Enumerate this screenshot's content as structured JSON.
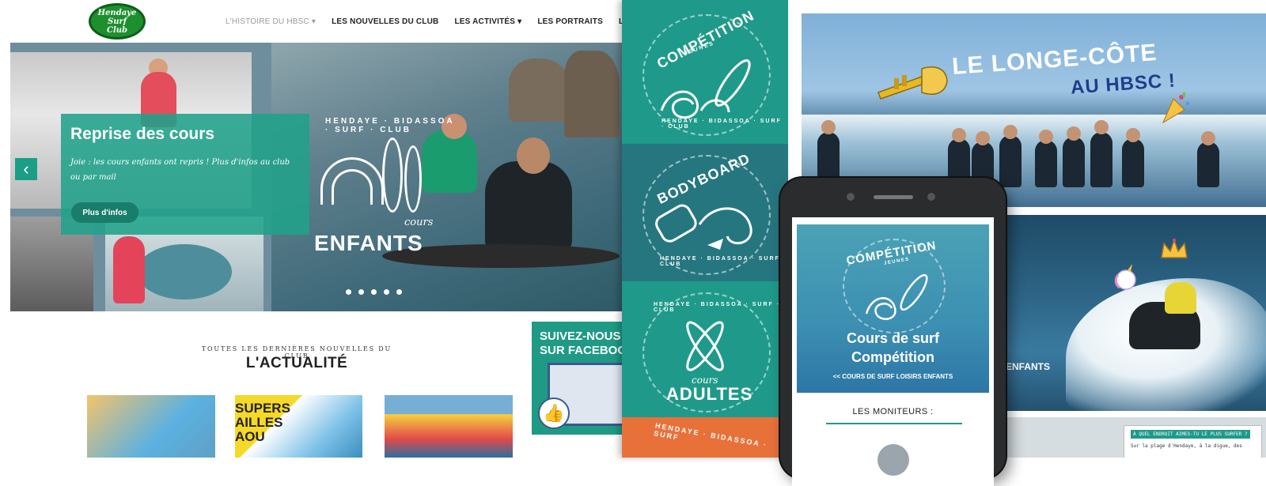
{
  "site": {
    "logo_line1": "Hendaye",
    "logo_line2": "Surf",
    "logo_line3": "Club",
    "nav": [
      {
        "label": "L'HISTOIRE DU HBSC",
        "caret": "▾",
        "active": false
      },
      {
        "label": "LES NOUVELLES DU CLUB",
        "caret": "",
        "active": true
      },
      {
        "label": "LES ACTIVITÉS",
        "caret": "▾",
        "active": true
      },
      {
        "label": "LES PORTRAITS",
        "caret": "",
        "active": true
      },
      {
        "label": "LES PRÉVISIONS",
        "caret": "",
        "active": true
      }
    ],
    "hero": {
      "title": "Reprise des cours",
      "text": "Joie : les cours enfants ont repris ! Plus d'infos au club ou par mail",
      "button": "Plus d'infos",
      "prev_icon": "chevron-left-icon",
      "slide_count": 5,
      "badge_arc": "HENDAYE · BIDASSOA · SURF · CLUB",
      "badge_cours": "cours",
      "badge_title": "ENFANTS"
    },
    "news": {
      "subtitle": "TOUTES LES DERNIÈRES NOUVELLES DU CLUB",
      "title": "L'ACTUALITÉ",
      "thumb2_text": "SUPERS\nAILLES\nAOU"
    },
    "facebook": {
      "title_line1": "SUIVEZ-NOUS",
      "title_line2": "SUR FACEBOOK",
      "like_icon": "thumbs-up-icon"
    }
  },
  "badges": [
    {
      "title": "COMPÉTITION",
      "sub": "JEUNES",
      "arc": "HENDAYE · BIDASSOA · SURF · CLUB"
    },
    {
      "title": "BODYBOARD",
      "sub": "",
      "arc": "HENDAYE · BIDASSOA · SURF · CLUB"
    },
    {
      "title": "ADULTES",
      "sub": "cours",
      "arc": "HENDAYE · BIDASSOA · SURF · CLUB"
    },
    {
      "title": "",
      "sub": "",
      "arc": "HENDAYE · BIDASSOA · SURF"
    }
  ],
  "longe": {
    "title_line1": "LE LONGE-CÔTE",
    "title_line2": "AU HBSC !",
    "emoji_left": "trumpet-icon",
    "emoji_right": "party-popper-icon"
  },
  "surf_photo": {
    "badge": "ENFANTS",
    "emoji_crown": "crown-icon",
    "emoji_unicorn": "unicorn-icon"
  },
  "bottom_photo": {
    "quote_head": "À QUEL ENDROIT AIMES-TU LE PLUS SURFER ?",
    "quote_text": "Sur la plage d'Hendaye, à la digue, des"
  },
  "phone": {
    "badge_title": "COMPÉTITION",
    "badge_sub": "JEUNES",
    "title_line1": "Cours de surf",
    "title_line2": "Compétition",
    "link": "<< COURS DE SURF LOISIRS ENFANTS",
    "section": "LES MONITEURS :"
  },
  "colors": {
    "teal": "#1f9a8a",
    "teal_dark": "#26767f",
    "orange": "#e8713a",
    "navy": "#1d3e8c"
  }
}
